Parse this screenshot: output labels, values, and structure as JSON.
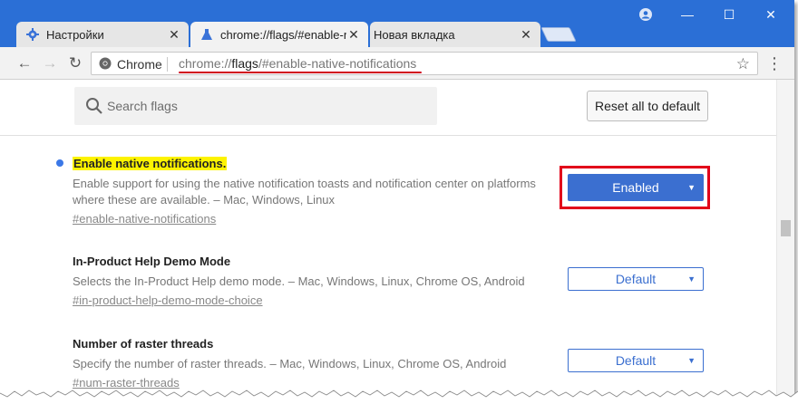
{
  "tabs": [
    {
      "title": "Настройки",
      "icon": "gear-icon"
    },
    {
      "title": "chrome://flags/#enable-n",
      "icon": "flask-icon"
    },
    {
      "title": "Новая вкладка",
      "icon": ""
    }
  ],
  "toolbar": {
    "site_label": "Chrome",
    "url_prefix": "chrome://",
    "url_host": "flags",
    "url_rest": "/#enable-native-notifications"
  },
  "search": {
    "placeholder": "Search flags"
  },
  "reset_label": "Reset all to default",
  "experiments": [
    {
      "title": "Enable native notifications.",
      "description": "Enable support for using the native notification toasts and notification center on platforms where these are available. – Mac, Windows, Linux",
      "link": "#enable-native-notifications",
      "value": "Enabled"
    },
    {
      "title": "In-Product Help Demo Mode",
      "description": "Selects the In-Product Help demo mode. – Mac, Windows, Linux, Chrome OS, Android",
      "link": "#in-product-help-demo-mode-choice",
      "value": "Default"
    },
    {
      "title": "Number of raster threads",
      "description": "Specify the number of raster threads. – Mac, Windows, Linux, Chrome OS, Android",
      "link": "#num-raster-threads",
      "value": "Default"
    }
  ],
  "colors": {
    "frame": "#2b6fd6",
    "accent": "#3b6fd0",
    "highlight": "#fdf300",
    "annotation_red": "#e2001a"
  }
}
